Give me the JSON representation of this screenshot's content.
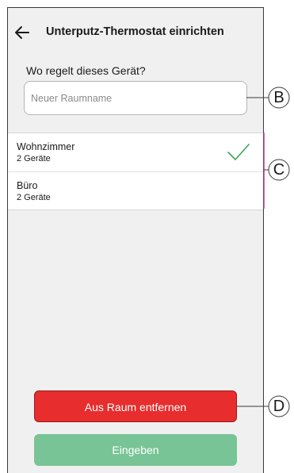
{
  "header": {
    "title": "Unterputz-Thermostat einrichten"
  },
  "form": {
    "question": "Wo regelt dieses Gerät?",
    "room_name_placeholder": "Neuer Raumname",
    "room_name_value": ""
  },
  "rooms": [
    {
      "name": "Wohnzimmer",
      "devices": "2 Geräte",
      "selected": true
    },
    {
      "name": "Büro",
      "devices": "2 Geräte",
      "selected": false
    }
  ],
  "buttons": {
    "remove_label": "Aus Raum entfernen",
    "enter_label": "Eingeben"
  },
  "callouts": {
    "b": "B",
    "c": "C",
    "d": "D"
  },
  "colors": {
    "remove_button": "#e72d2d",
    "enter_button": "#79c496",
    "check_mark": "#3aa655",
    "callout_line_b": "#3a3a3a",
    "callout_line_c": "#c0397a",
    "callout_line_d": "#3a3a3a"
  },
  "icons": {
    "back": "arrow-left-icon",
    "selected": "check-icon"
  }
}
